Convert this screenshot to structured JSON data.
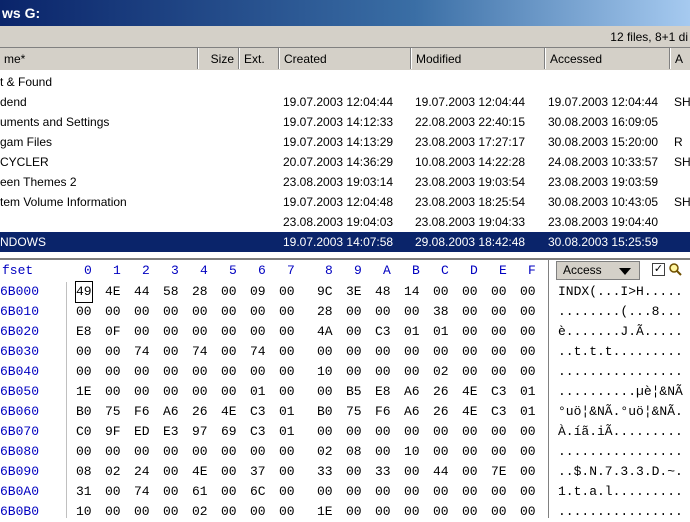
{
  "window": {
    "title": "ws G:"
  },
  "info": {
    "count": "12 files, 8+1 di"
  },
  "columns": [
    "me*",
    "Size",
    "Ext.",
    "Created",
    "Modified",
    "Accessed",
    "A"
  ],
  "files": [
    {
      "name": "t & Found",
      "created": "",
      "modified": "",
      "accessed": "",
      "attr": "",
      "selected": false
    },
    {
      "name": "dend",
      "created": "19.07.2003 12:04:44",
      "modified": "19.07.2003 12:04:44",
      "accessed": "19.07.2003 12:04:44",
      "attr": "SH",
      "selected": false
    },
    {
      "name": "uments and Settings",
      "created": "19.07.2003 14:12:33",
      "modified": "22.08.2003 22:40:15",
      "accessed": "30.08.2003 16:09:05",
      "attr": "",
      "selected": false
    },
    {
      "name": "gam Files",
      "created": "19.07.2003 14:13:29",
      "modified": "23.08.2003 17:27:17",
      "accessed": "30.08.2003 15:20:00",
      "attr": "R",
      "selected": false
    },
    {
      "name": "CYCLER",
      "created": "20.07.2003 14:36:29",
      "modified": "10.08.2003 14:22:28",
      "accessed": "24.08.2003 10:33:57",
      "attr": "SH",
      "selected": false
    },
    {
      "name": "een Themes 2",
      "created": "23.08.2003 19:03:14",
      "modified": "23.08.2003 19:03:54",
      "accessed": "23.08.2003 19:03:59",
      "attr": "",
      "selected": false
    },
    {
      "name": "tem Volume Information",
      "created": "19.07.2003 12:04:48",
      "modified": "23.08.2003 18:25:54",
      "accessed": "30.08.2003 10:43:05",
      "attr": "SH",
      "selected": false
    },
    {
      "name": "",
      "created": "23.08.2003 19:04:03",
      "modified": "23.08.2003 19:04:33",
      "accessed": "23.08.2003 19:04:40",
      "attr": "",
      "selected": false
    },
    {
      "name": "NDOWS",
      "created": "19.07.2003 14:07:58",
      "modified": "29.08.2003 18:42:48",
      "accessed": "30.08.2003 15:25:59",
      "attr": "",
      "selected": true
    }
  ],
  "hex": {
    "offset_label": "fset",
    "columns": [
      "0",
      "1",
      "2",
      "3",
      "4",
      "5",
      "6",
      "7",
      "8",
      "9",
      "A",
      "B",
      "C",
      "D",
      "E",
      "F"
    ],
    "access_label": "Access",
    "rows": [
      {
        "offset": "6B000",
        "bytes": [
          "49",
          "4E",
          "44",
          "58",
          "28",
          "00",
          "09",
          "00",
          "9C",
          "3E",
          "48",
          "14",
          "00",
          "00",
          "00",
          "00"
        ],
        "ascii": "INDX(...I>H....."
      },
      {
        "offset": "6B010",
        "bytes": [
          "00",
          "00",
          "00",
          "00",
          "00",
          "00",
          "00",
          "00",
          "28",
          "00",
          "00",
          "00",
          "38",
          "00",
          "00",
          "00"
        ],
        "ascii": "........(...8..."
      },
      {
        "offset": "6B020",
        "bytes": [
          "E8",
          "0F",
          "00",
          "00",
          "00",
          "00",
          "00",
          "00",
          "4A",
          "00",
          "C3",
          "01",
          "01",
          "00",
          "00",
          "00"
        ],
        "ascii": "è.......J.Ã....."
      },
      {
        "offset": "6B030",
        "bytes": [
          "00",
          "00",
          "74",
          "00",
          "74",
          "00",
          "74",
          "00",
          "00",
          "00",
          "00",
          "00",
          "00",
          "00",
          "00",
          "00"
        ],
        "ascii": "..t.t.t........."
      },
      {
        "offset": "6B040",
        "bytes": [
          "00",
          "00",
          "00",
          "00",
          "00",
          "00",
          "00",
          "00",
          "10",
          "00",
          "00",
          "00",
          "02",
          "00",
          "00",
          "00"
        ],
        "ascii": "................"
      },
      {
        "offset": "6B050",
        "bytes": [
          "1E",
          "00",
          "00",
          "00",
          "00",
          "00",
          "01",
          "00",
          "00",
          "B5",
          "E8",
          "A6",
          "26",
          "4E",
          "C3",
          "01"
        ],
        "ascii": "..........µè¦&NÃ"
      },
      {
        "offset": "6B060",
        "bytes": [
          "B0",
          "75",
          "F6",
          "A6",
          "26",
          "4E",
          "C3",
          "01",
          "B0",
          "75",
          "F6",
          "A6",
          "26",
          "4E",
          "C3",
          "01"
        ],
        "ascii": "°uö¦&NÃ.°uö¦&NÃ."
      },
      {
        "offset": "6B070",
        "bytes": [
          "C0",
          "9F",
          "ED",
          "E3",
          "97",
          "69",
          "C3",
          "01",
          "00",
          "00",
          "00",
          "00",
          "00",
          "00",
          "00",
          "00"
        ],
        "ascii": "À.íã.iÃ........."
      },
      {
        "offset": "6B080",
        "bytes": [
          "00",
          "00",
          "00",
          "00",
          "00",
          "00",
          "00",
          "00",
          "02",
          "08",
          "00",
          "10",
          "00",
          "00",
          "00",
          "00"
        ],
        "ascii": "................"
      },
      {
        "offset": "6B090",
        "bytes": [
          "08",
          "02",
          "24",
          "00",
          "4E",
          "00",
          "37",
          "00",
          "33",
          "00",
          "33",
          "00",
          "44",
          "00",
          "7E",
          "00"
        ],
        "ascii": "..$.N.7.3.3.D.~."
      },
      {
        "offset": "6B0A0",
        "bytes": [
          "31",
          "00",
          "74",
          "00",
          "61",
          "00",
          "6C",
          "00",
          "00",
          "00",
          "00",
          "00",
          "00",
          "00",
          "00",
          "00"
        ],
        "ascii": "1.t.a.l........."
      },
      {
        "offset": "6B0B0",
        "bytes": [
          "10",
          "00",
          "00",
          "00",
          "02",
          "00",
          "00",
          "00",
          "1E",
          "00",
          "00",
          "00",
          "00",
          "00",
          "00",
          "00"
        ],
        "ascii": "................"
      }
    ]
  }
}
